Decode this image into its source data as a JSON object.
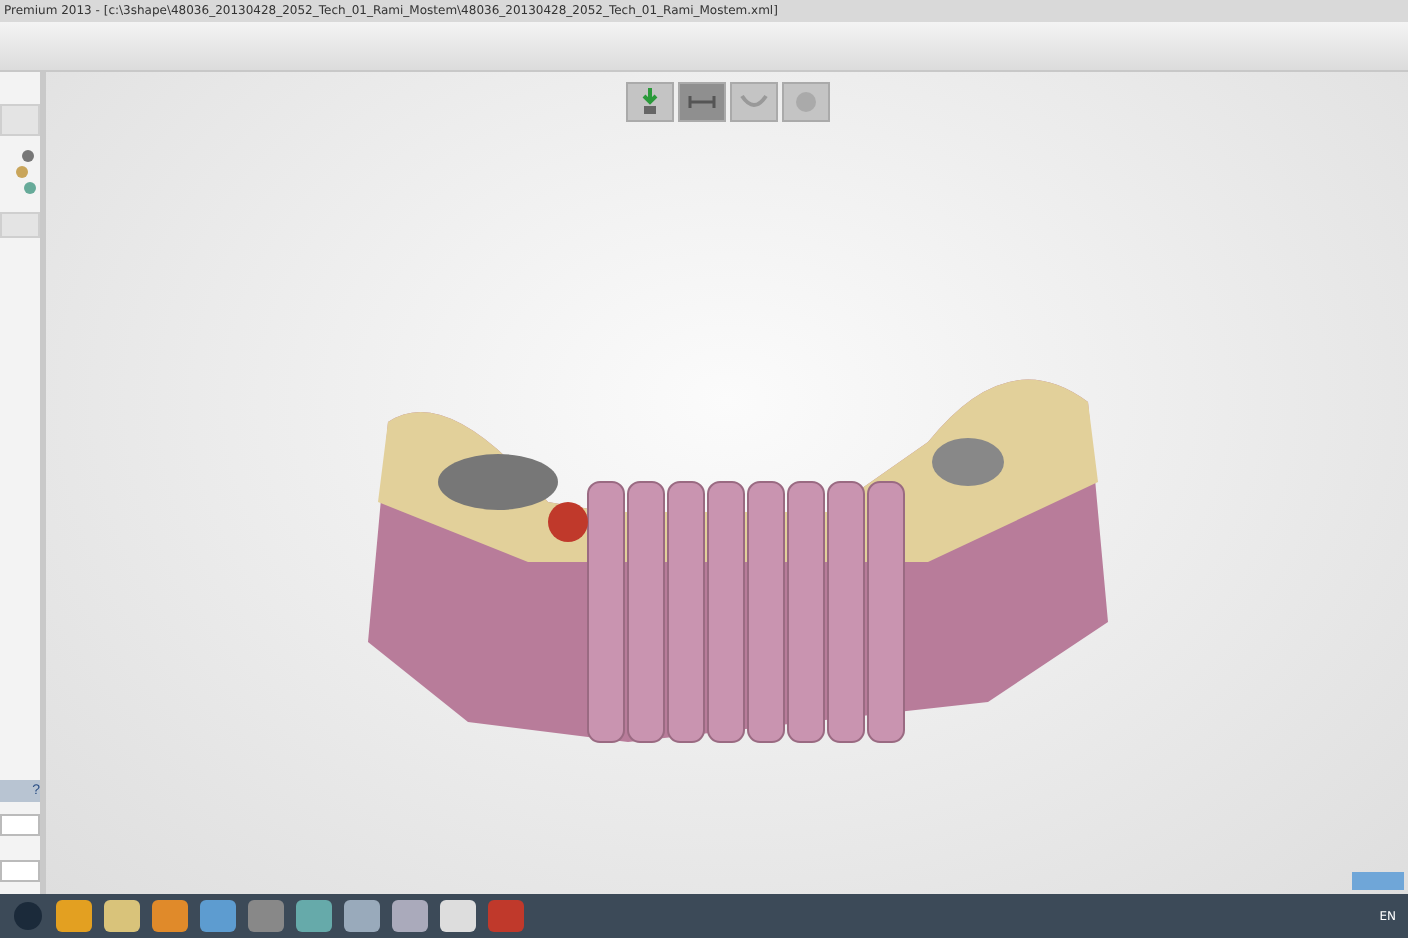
{
  "window": {
    "title": "Premium 2013 - [c:\\3shape\\48036_20130428_2052_Tech_01_Rami_Mostem\\48036_20130428_2052_Tech_01_Rami_Mostem.xml]"
  },
  "view_tools": [
    {
      "kind": "tooth",
      "selected": false
    },
    {
      "kind": "arch",
      "selected": true
    },
    {
      "kind": "jaw",
      "selected": false
    },
    {
      "kind": "bridge",
      "selected": false
    }
  ],
  "side_panel": {
    "help": "?"
  },
  "taskbar": {
    "language": "EN"
  }
}
